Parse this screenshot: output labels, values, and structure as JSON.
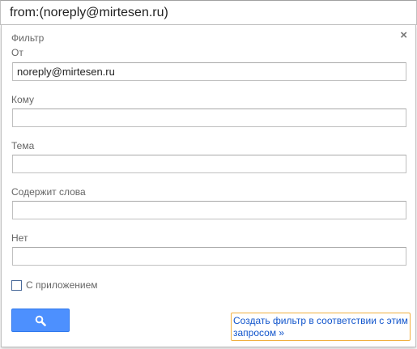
{
  "search": {
    "query": "from:(noreply@mirtesen.ru)"
  },
  "filter_panel": {
    "title": "Фильтр",
    "close_symbol": "×",
    "fields": [
      {
        "label": "От",
        "value": "noreply@mirtesen.ru"
      },
      {
        "label": "Кому",
        "value": ""
      },
      {
        "label": "Тема",
        "value": ""
      },
      {
        "label": "Содержит слова",
        "value": ""
      },
      {
        "label": "Нет",
        "value": ""
      }
    ],
    "has_attachment": {
      "label": "С приложением",
      "checked": false
    },
    "search_button_icon": "search-icon",
    "create_filter_link": "Создать фильтр в соответствии с этим запросом »"
  },
  "colors": {
    "button_blue": "#4d90fe",
    "link_blue": "#1155cc",
    "focus_outline": "#f0b040"
  }
}
